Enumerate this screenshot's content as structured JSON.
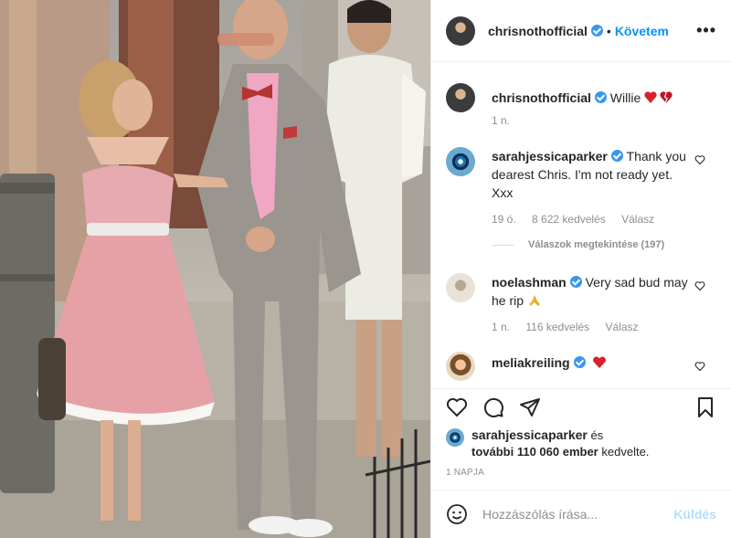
{
  "header": {
    "username": "chrisnothofficial",
    "separator": "•",
    "follow_label": "Követem",
    "more_icon": "•••"
  },
  "caption": {
    "username": "chrisnothofficial",
    "text": "Willie",
    "time": "1 n."
  },
  "comments": [
    {
      "username": "sarahjessicaparker",
      "text_line1": "Thank you",
      "text_line2": "dearest Chris. I'm not ready yet.",
      "text_line3": "Xxx",
      "time": "19 ó.",
      "likes": "8 622 kedvelés",
      "reply": "Válasz",
      "view_replies": "Válaszok megtekintése (197)"
    },
    {
      "username": "noelashman",
      "text_line1": "Very sad bud may",
      "text_line2": "he rip",
      "time": "1 n.",
      "likes": "116 kedvelés",
      "reply": "Válasz"
    },
    {
      "username": "meliakreiling"
    }
  ],
  "likes": {
    "user": "sarahjessicaparker",
    "and": "és",
    "count_text": "további 110 060 ember",
    "suffix": "kedvelte."
  },
  "post_time": "1 NAPJA",
  "add_comment": {
    "placeholder": "Hozzászólás írása...",
    "send_label": "Küldés"
  },
  "colors": {
    "accent": "#0095f6",
    "verified": "#3897f0",
    "heart": "#ed4956"
  },
  "icons": [
    "heart-icon",
    "comment-icon",
    "share-icon",
    "bookmark-icon",
    "smiley-icon",
    "broken-heart-icon",
    "pray-icon"
  ]
}
